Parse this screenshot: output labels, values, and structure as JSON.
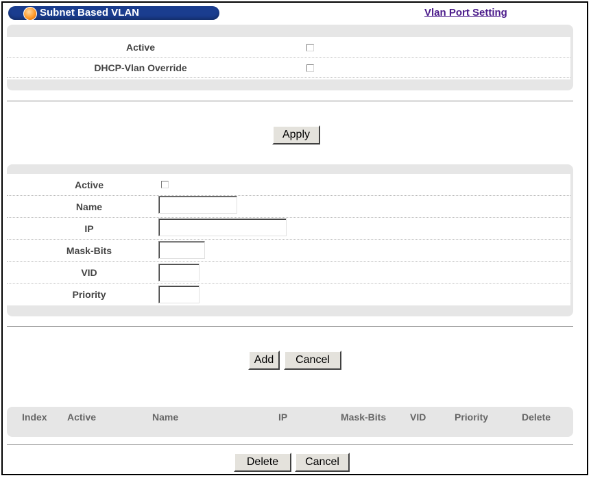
{
  "header": {
    "title": "Subnet Based VLAN",
    "link": "Vlan Port Setting"
  },
  "global_settings": {
    "active_label": "Active",
    "dhcp_override_label": "DHCP-Vlan Override",
    "apply_label": "Apply"
  },
  "entry_form": {
    "active_label": "Active",
    "name_label": "Name",
    "ip_label": "IP",
    "mask_bits_label": "Mask-Bits",
    "vid_label": "VID",
    "priority_label": "Priority",
    "name_value": "",
    "ip_value": "",
    "mask_bits_value": "",
    "vid_value": "",
    "priority_value": "",
    "add_label": "Add",
    "cancel_label": "Cancel"
  },
  "table": {
    "columns": [
      "Index",
      "Active",
      "Name",
      "IP",
      "Mask-Bits",
      "VID",
      "Priority",
      "Delete"
    ],
    "rows": [],
    "delete_label": "Delete",
    "cancel_label": "Cancel"
  },
  "colors": {
    "title_bar": "#1a3d8f",
    "link": "#4a1a8a",
    "panel": "#e6e6e6"
  }
}
